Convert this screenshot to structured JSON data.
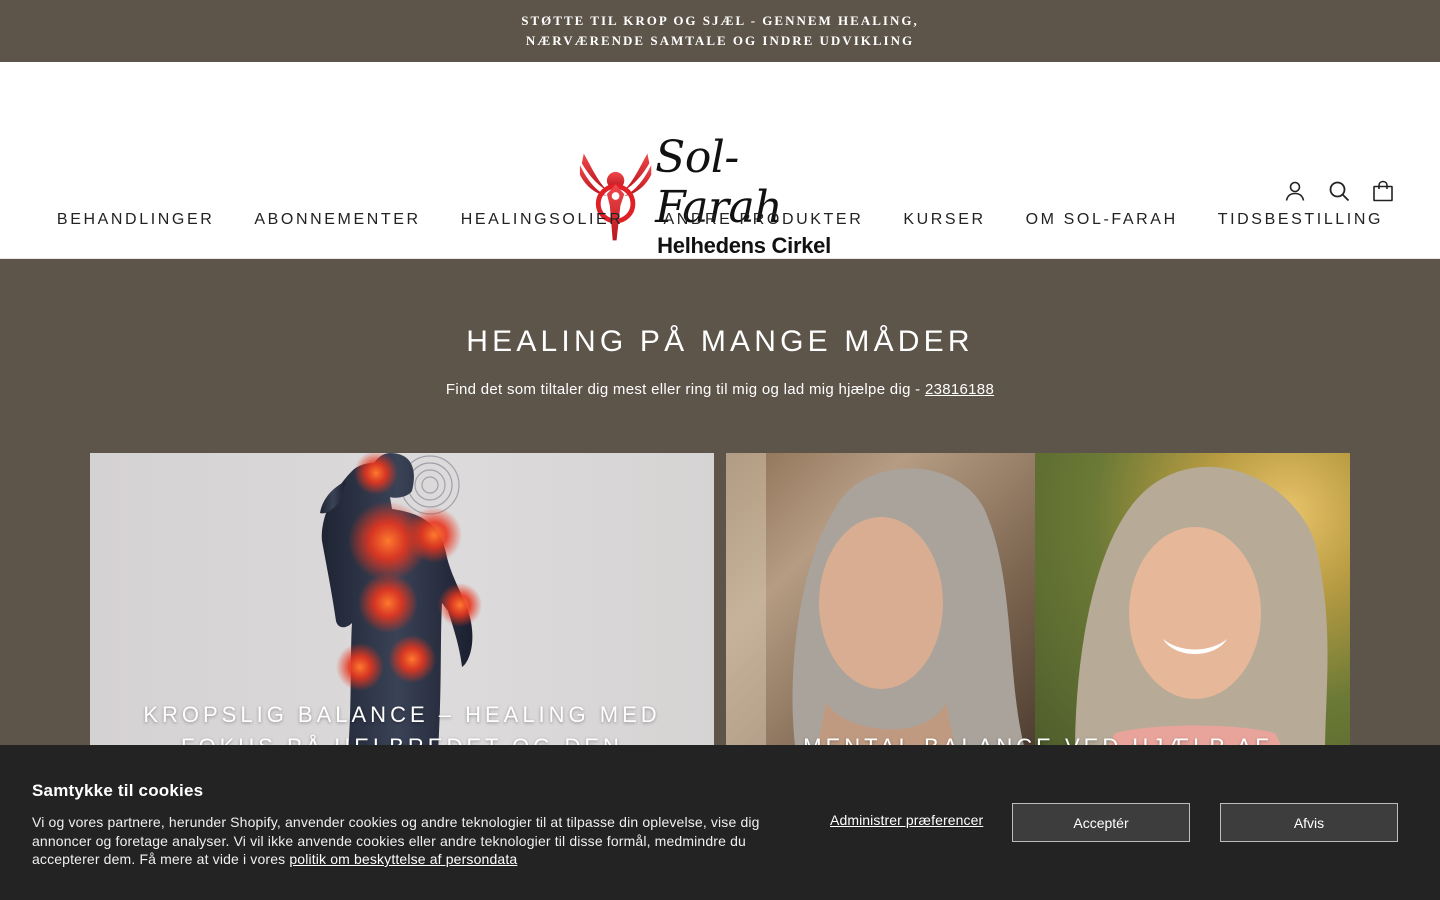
{
  "announcement": "STØTTE TIL KROP OG SJÆL - GENNEM HEALING, NÆRVÆRENDE SAMTALE OG INDRE UDVIKLING",
  "logo": {
    "name": "Sol-Farah",
    "subtitle": "Helhedens Cirkel",
    "brand_color": "#e02027"
  },
  "header_icons": [
    "account-icon",
    "search-icon",
    "cart-icon"
  ],
  "nav": {
    "items": [
      "BEHANDLINGER",
      "ABONNEMENTER",
      "HEALINGSOLIER",
      "ANDRE PRODUKTER",
      "KURSER",
      "OM SOL-FARAH",
      "TIDSBESTILLING"
    ]
  },
  "main": {
    "title": "HEALING PÅ MANGE MÅDER",
    "subtitle_text": "Find det som tiltaler dig mest eller ring til mig og lad mig hjælpe dig - ",
    "phone": "23816188",
    "background_color": "#5d544a"
  },
  "cards": [
    {
      "title": "KROPSLIG BALANCE – HEALING MED FOKUS PÅ HELBREDET OG DEN"
    },
    {
      "title": "MENTAL BALANCE VED HJÆLP AF"
    }
  ],
  "cookie": {
    "title": "Samtykke til cookies",
    "text": "Vi og vores partnere, herunder Shopify, anvender cookies og andre teknologier til at tilpasse din oplevelse, vise dig annoncer og foretage analyser. Vi vil ikke anvende cookies eller andre teknologier til disse formål, medmindre du accepterer dem. Få mere at vide i vores ",
    "policy_link": "politik om beskyttelse af persondata",
    "manage_label": "Administrer præferencer",
    "accept_label": "Acceptér",
    "decline_label": "Afvis"
  }
}
